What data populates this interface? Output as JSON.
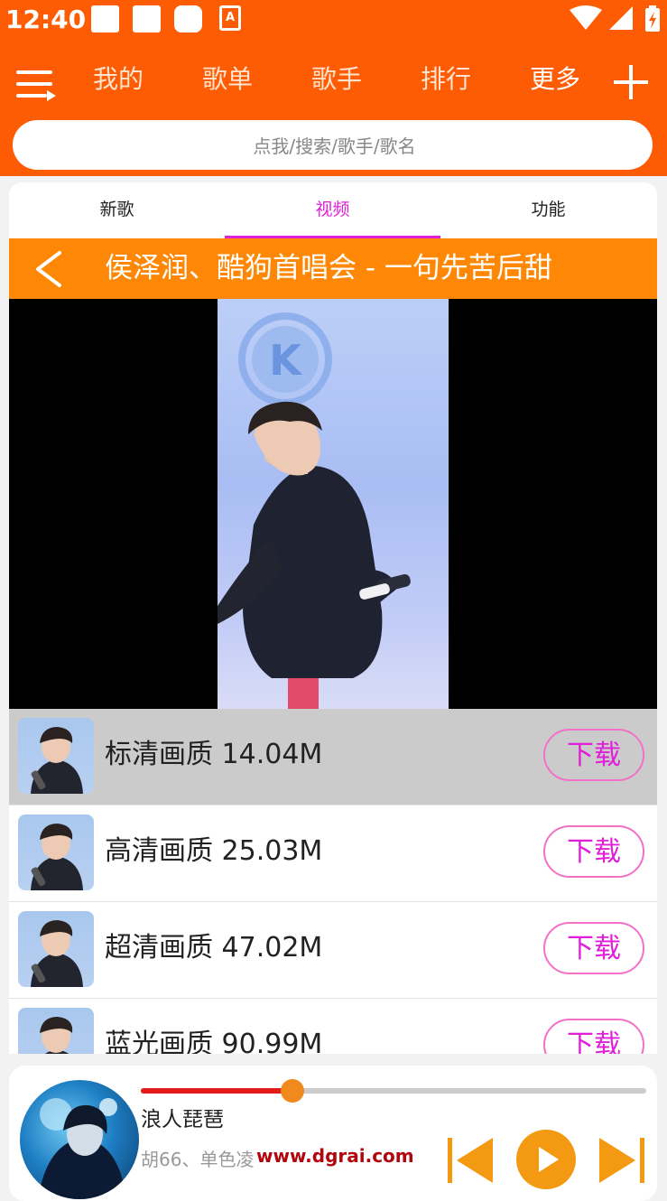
{
  "status_bar": {
    "time": "12:40",
    "notification_icons": [
      "square-notification-icon",
      "square-notification-icon",
      "square-notification-icon",
      "font-notification-icon"
    ],
    "status_icons": [
      "wifi-icon",
      "signal-icon",
      "battery-charging-icon"
    ],
    "font_icon_letter": "A"
  },
  "nav": {
    "items": [
      {
        "label": "我的",
        "active": false
      },
      {
        "label": "歌单",
        "active": false
      },
      {
        "label": "歌手",
        "active": false
      },
      {
        "label": "排行",
        "active": false
      },
      {
        "label": "更多",
        "active": true
      }
    ],
    "menu_icon": "playlist-menu-icon",
    "add_icon": "plus-icon"
  },
  "search": {
    "placeholder": "点我/搜索/歌手/歌名",
    "value": ""
  },
  "tabs": [
    {
      "label": "新歌",
      "active": false
    },
    {
      "label": "视频",
      "active": true
    },
    {
      "label": "功能",
      "active": false
    }
  ],
  "video": {
    "title": "侯泽润、酷狗首唱会 - 一句先苦后甜",
    "back_icon": "chevron-left-icon"
  },
  "qualities": [
    {
      "label": "标清画质 14.04M",
      "button": "下载",
      "selected": true
    },
    {
      "label": "高清画质 25.03M",
      "button": "下载",
      "selected": false
    },
    {
      "label": "超清画质 47.02M",
      "button": "下载",
      "selected": false
    },
    {
      "label": "蓝光画质 90.99M",
      "button": "下载",
      "selected": false
    }
  ],
  "now_playing": {
    "title": "浪人琵琶",
    "artist": "胡66、单色凌",
    "watermark": "www.dgrai.com",
    "progress": 0.3,
    "controls": [
      "previous-icon",
      "play-icon",
      "next-icon"
    ]
  },
  "colors": {
    "header": "#fd5c05",
    "title_bar": "#fe8805",
    "accent": "#e01fd8",
    "control": "#f49a12",
    "progress": "#e21b1b"
  }
}
